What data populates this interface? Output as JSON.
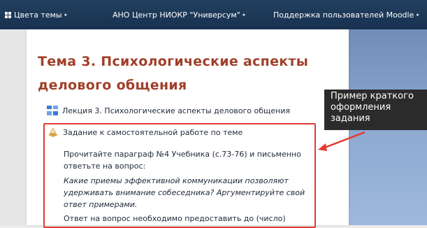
{
  "topnav": {
    "theme_colors_label": "Цвета темы",
    "org_label": "АНО Центр НИОКР \"Универсум\"",
    "support_label": "Поддержка пользователей Moodle",
    "caret": "▸"
  },
  "section": {
    "title": "Тема 3. Психологические аспекты делового общения"
  },
  "activities": [
    {
      "label": "Лекция 3. Психологические аспекты делового общения",
      "icon": "page-icon"
    },
    {
      "label": "Задание к самостоятельной работе по теме",
      "icon": "assignment-icon"
    }
  ],
  "assignment": {
    "instruction": "Прочитайте параграф №4 Учебника (с.73-76) и письменно ответьте на вопрос:",
    "question": "Какие приемы эффективной коммуникации позволяют удерживать внимание собеседника? Аргументируйте свой ответ примерами.",
    "deadline": "Ответ на вопрос необходимо предоставить до (число)"
  },
  "callout": {
    "text": "Пример краткого оформления задания"
  },
  "colors": {
    "nav_bg": "#1d3557",
    "title": "#a0402a",
    "highlight": "#e03c33",
    "callout_bg": "#2b2b2b"
  }
}
